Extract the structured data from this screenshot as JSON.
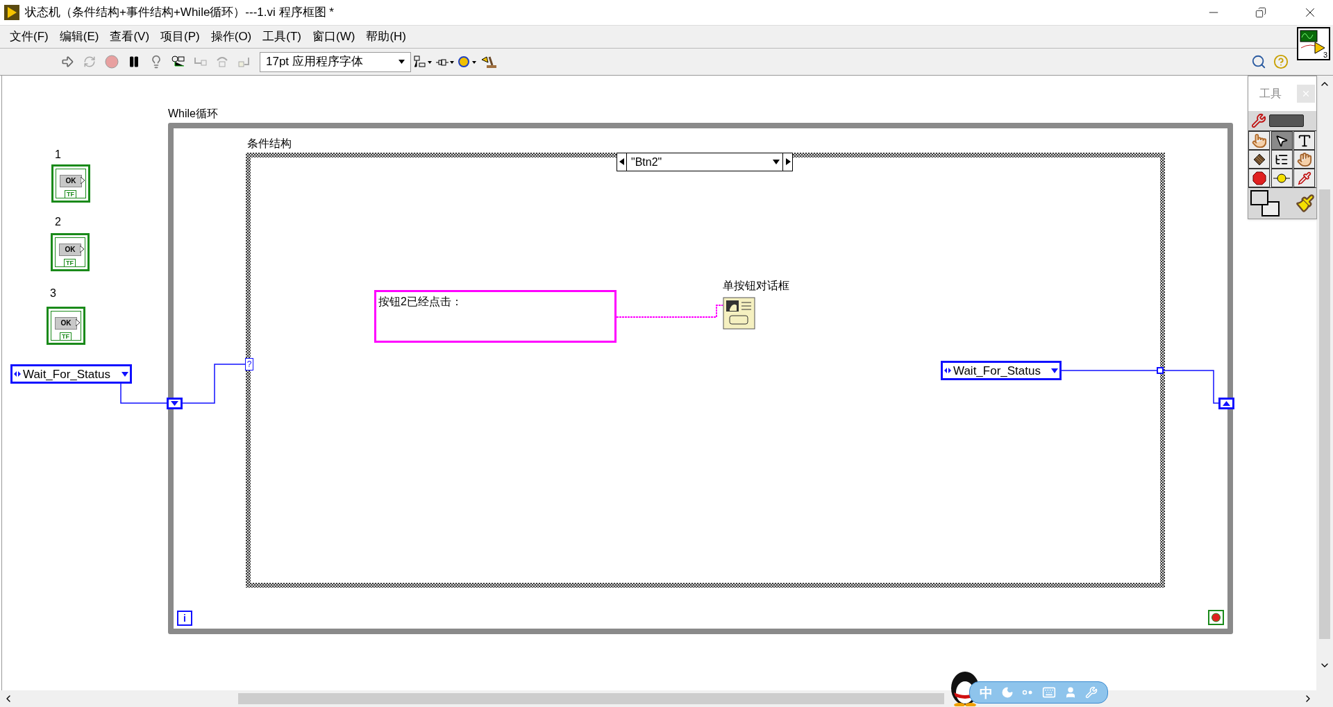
{
  "window": {
    "title": "状态机（条件结构+事件结构+While循环）---1.vi 程序框图 *"
  },
  "menu": [
    "文件(F)",
    "编辑(E)",
    "查看(V)",
    "项目(P)",
    "操作(O)",
    "工具(T)",
    "窗口(W)",
    "帮助(H)"
  ],
  "toolbar": {
    "font": "17pt 应用程序字体"
  },
  "vi_icon": {
    "badge": "3"
  },
  "diagram": {
    "while_loop": {
      "label": "While循环",
      "iteration_terminal": "i"
    },
    "case_structure": {
      "label": "条件结构",
      "selector": "\"Btn2\"",
      "terminal": "?"
    },
    "buttons": [
      {
        "label": "1",
        "caption": "OK",
        "type": "TF"
      },
      {
        "label": "2",
        "caption": "OK",
        "type": "TF"
      },
      {
        "label": "3",
        "caption": "OK",
        "type": "TF"
      }
    ],
    "enums": [
      {
        "value": "Wait_For_Status"
      },
      {
        "value": "Wait_For_Status"
      }
    ],
    "string_constant": "按钮2已经点击：",
    "dialog_node": {
      "label": "单按钮对话框"
    }
  },
  "tools_palette": {
    "title": "工具",
    "tools": [
      {
        "kind": "operate",
        "selected": false
      },
      {
        "kind": "position",
        "selected": true
      },
      {
        "kind": "text",
        "selected": false
      },
      {
        "kind": "wire",
        "selected": false
      },
      {
        "kind": "menu",
        "selected": false
      },
      {
        "kind": "scroll",
        "selected": false
      },
      {
        "kind": "breakpoint",
        "selected": false
      },
      {
        "kind": "probe",
        "selected": false
      },
      {
        "kind": "dropper",
        "selected": false
      }
    ]
  },
  "ime_bar": {
    "mode": "中"
  }
}
